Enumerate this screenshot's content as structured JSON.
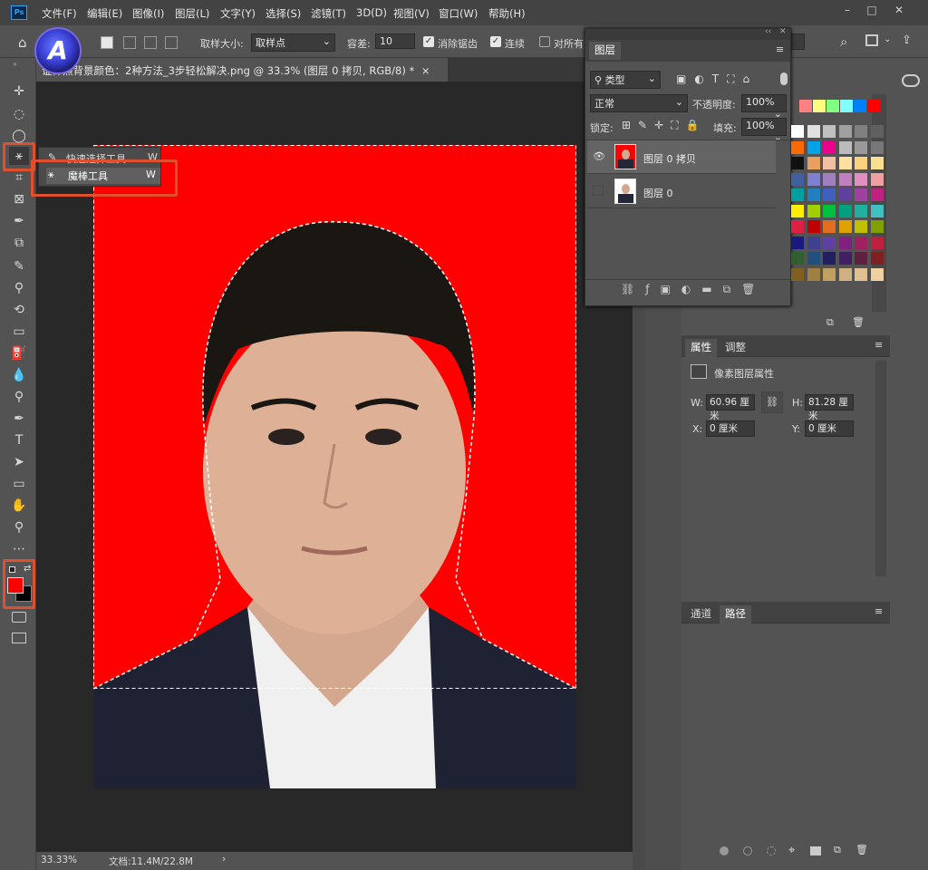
{
  "menubar": {
    "ps_logo": "Ps",
    "items": [
      "文件(F)",
      "编辑(E)",
      "图像(I)",
      "图层(L)",
      "文字(Y)",
      "选择(S)",
      "滤镜(T)",
      "3D(D)",
      "视图(V)",
      "窗口(W)",
      "帮助(H)"
    ]
  },
  "options": {
    "sample_size_label": "取样大小:",
    "sample_size_value": "取样点",
    "tolerance_label": "容差:",
    "tolerance_value": "10",
    "anti_alias_label": "消除锯齿",
    "contiguous_label": "连续",
    "sample_all_label": "对所有图"
  },
  "document": {
    "tab_title": "证件照背景颜色：2种方法_3步轻松解决.png @ 33.3% (图层 0 拷贝, RGB/8) *",
    "tab_close": "×"
  },
  "tool_flyout": {
    "items": [
      {
        "label": "快速选择工具",
        "shortcut": "W"
      },
      {
        "label": "魔棒工具",
        "shortcut": "W"
      }
    ]
  },
  "layers_panel": {
    "title": "图层",
    "filter": "类型",
    "blend_mode": "正常",
    "opacity_label": "不透明度:",
    "opacity_value": "100%",
    "lock_label": "锁定:",
    "fill_label": "填充:",
    "fill_value": "100%",
    "layers": [
      {
        "name": "图层 0 拷贝",
        "visible": true,
        "bg": "#ff0000"
      },
      {
        "name": "图层 0",
        "visible": false,
        "bg": "#ffffff"
      }
    ],
    "footer_icons": [
      "link-icon",
      "fx-icon",
      "mask-icon",
      "adjustment-icon",
      "folder-icon",
      "new-layer-icon",
      "trash-icon"
    ]
  },
  "properties_panel": {
    "tabs": [
      "属性",
      "调整"
    ],
    "section": "像素图层属性",
    "w_label": "W:",
    "w_value": "60.96 厘米",
    "h_label": "H:",
    "h_value": "81.28 厘米",
    "x_label": "X:",
    "x_value": "0 厘米",
    "y_label": "Y:",
    "y_value": "0 厘米"
  },
  "paths_panel": {
    "tabs": [
      "通道",
      "路径"
    ]
  },
  "status": {
    "zoom": "33.33%",
    "doc_info": "文档:11.4M/22.8M",
    "arrow": "›"
  },
  "colors": {
    "foreground": "#ff0000",
    "background": "#000000",
    "highlight": "#e0502e",
    "canvas_red": "#ff0000"
  },
  "swatch_rows": [
    [
      "#ff8080",
      "#ffff80",
      "#80ff80",
      "#80ffff",
      "#0080ff",
      "#ff0000"
    ],
    [
      "#ffffff",
      "#e0e0e0",
      "#c0c0c0",
      "#a0a0a0",
      "#808080",
      "#606060"
    ],
    [
      "#ff6a00",
      "#00a2e8",
      "#ec008c",
      "#bbbbbb",
      "#999999",
      "#777777"
    ],
    [
      "#111111",
      "#e8a060",
      "#f0c0a0",
      "#ffe0a0",
      "#ffd080",
      "#f8e090"
    ],
    [
      "#4060a0",
      "#8080d0",
      "#a080c0",
      "#c080c0",
      "#e090c0",
      "#f0a0a0"
    ],
    [
      "#00a0a0",
      "#2080c0",
      "#4060c0",
      "#6040a0",
      "#a040a0",
      "#c02080"
    ],
    [
      "#ffee00",
      "#a0d000",
      "#00c040",
      "#00a080",
      "#20b0a0",
      "#40c0c0"
    ],
    [
      "#e02040",
      "#c00000",
      "#e07020",
      "#e0a000",
      "#c0c000",
      "#80a000"
    ],
    [
      "#1a1a80",
      "#404090",
      "#6040a0",
      "#802080",
      "#a02060",
      "#c02040"
    ],
    [
      "#306030",
      "#205080",
      "#202060",
      "#402060",
      "#602040",
      "#802020"
    ],
    [
      "#806020",
      "#a08040",
      "#c0a060",
      "#d0b080",
      "#e0c090",
      "#f0d0a0"
    ]
  ]
}
